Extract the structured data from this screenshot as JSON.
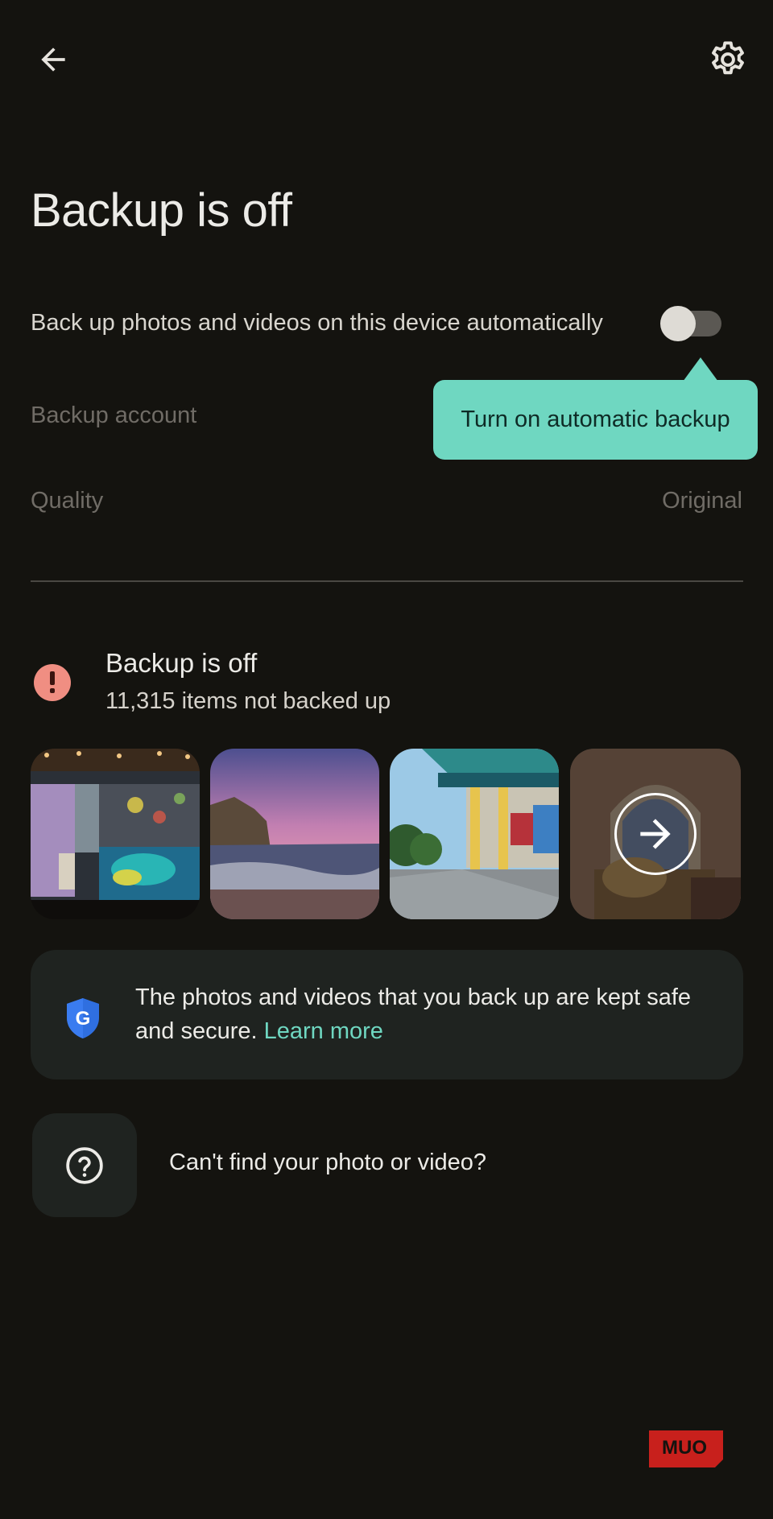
{
  "header": {
    "back_icon": "arrow-left-icon",
    "settings_icon": "gear-icon"
  },
  "page_title": "Backup is off",
  "auto_backup": {
    "label": "Back up photos and videos on this device automatically",
    "enabled": false
  },
  "tooltip": {
    "text": "Turn on automatic backup"
  },
  "settings": {
    "backup_account_label": "Backup account",
    "quality_label": "Quality",
    "quality_value": "Original"
  },
  "status": {
    "icon": "alert-icon",
    "title": "Backup is off",
    "subtitle": "11,315 items not backed up"
  },
  "thumbnails": [
    {
      "name": "photo-monitor-maps"
    },
    {
      "name": "photo-sunset-coast"
    },
    {
      "name": "photo-temple-pillars"
    },
    {
      "name": "photo-ornate-gate"
    }
  ],
  "info_card": {
    "icon": "google-shield-icon",
    "text": "The photos and videos that you back up are kept safe and secure.",
    "link": "Learn more"
  },
  "help": {
    "icon": "help-circle-icon",
    "label": "Can't find your photo or video?"
  },
  "watermark": {
    "text": "MUO"
  },
  "colors": {
    "background": "#14130f",
    "accent": "#6fd7c1",
    "alert": "#f08e82",
    "card": "#1f2320"
  }
}
